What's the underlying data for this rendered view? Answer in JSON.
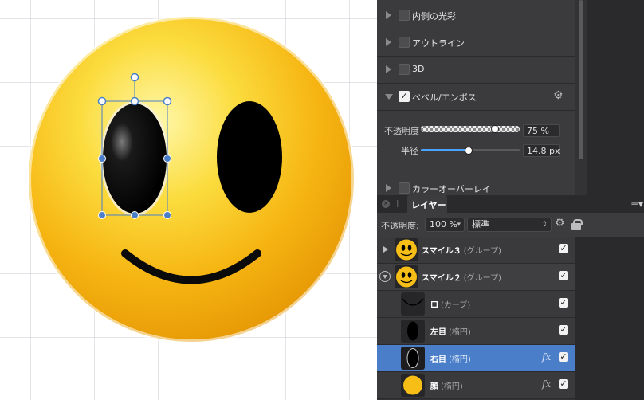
{
  "effects": {
    "items": [
      {
        "label": "内側の光彩",
        "checked": false,
        "expanded": false
      },
      {
        "label": "アウトライン",
        "checked": false,
        "expanded": false
      },
      {
        "label": "3D",
        "checked": false,
        "expanded": false
      },
      {
        "label": "ベベル/エンボス",
        "checked": true,
        "expanded": true
      },
      {
        "label": "カラーオーバーレイ",
        "checked": false,
        "expanded": false
      }
    ],
    "bevel": {
      "opacity_label": "不透明度",
      "opacity_value": "75 %",
      "opacity_fraction": 0.75,
      "radius_label": "半径",
      "radius_value": "14.8 px",
      "radius_fraction": 0.48
    },
    "gear_icon": "gear-icon"
  },
  "layers_panel": {
    "tab_label": "レイヤー",
    "opacity_label": "不透明度:",
    "opacity_value": "100 %",
    "blend_mode": "標準",
    "rows": [
      {
        "name": "スマイル３",
        "type": "(グループ)",
        "visible": true
      },
      {
        "name": "スマイル２",
        "type": "(グループ)",
        "visible": true
      },
      {
        "name": "口",
        "type": "(カーブ)",
        "visible": true
      },
      {
        "name": "左目",
        "type": "(楕円)",
        "visible": true
      },
      {
        "name": "右目",
        "type": "(楕円)",
        "visible": true,
        "selected": true,
        "fx": "fx"
      },
      {
        "name": "顔",
        "type": "(楕円)",
        "visible": true,
        "fx": "fx"
      }
    ]
  },
  "colors": {
    "accent": "#4a7ec9",
    "panel": "#3b3b3d",
    "face_yellow": "#f7c21a"
  }
}
